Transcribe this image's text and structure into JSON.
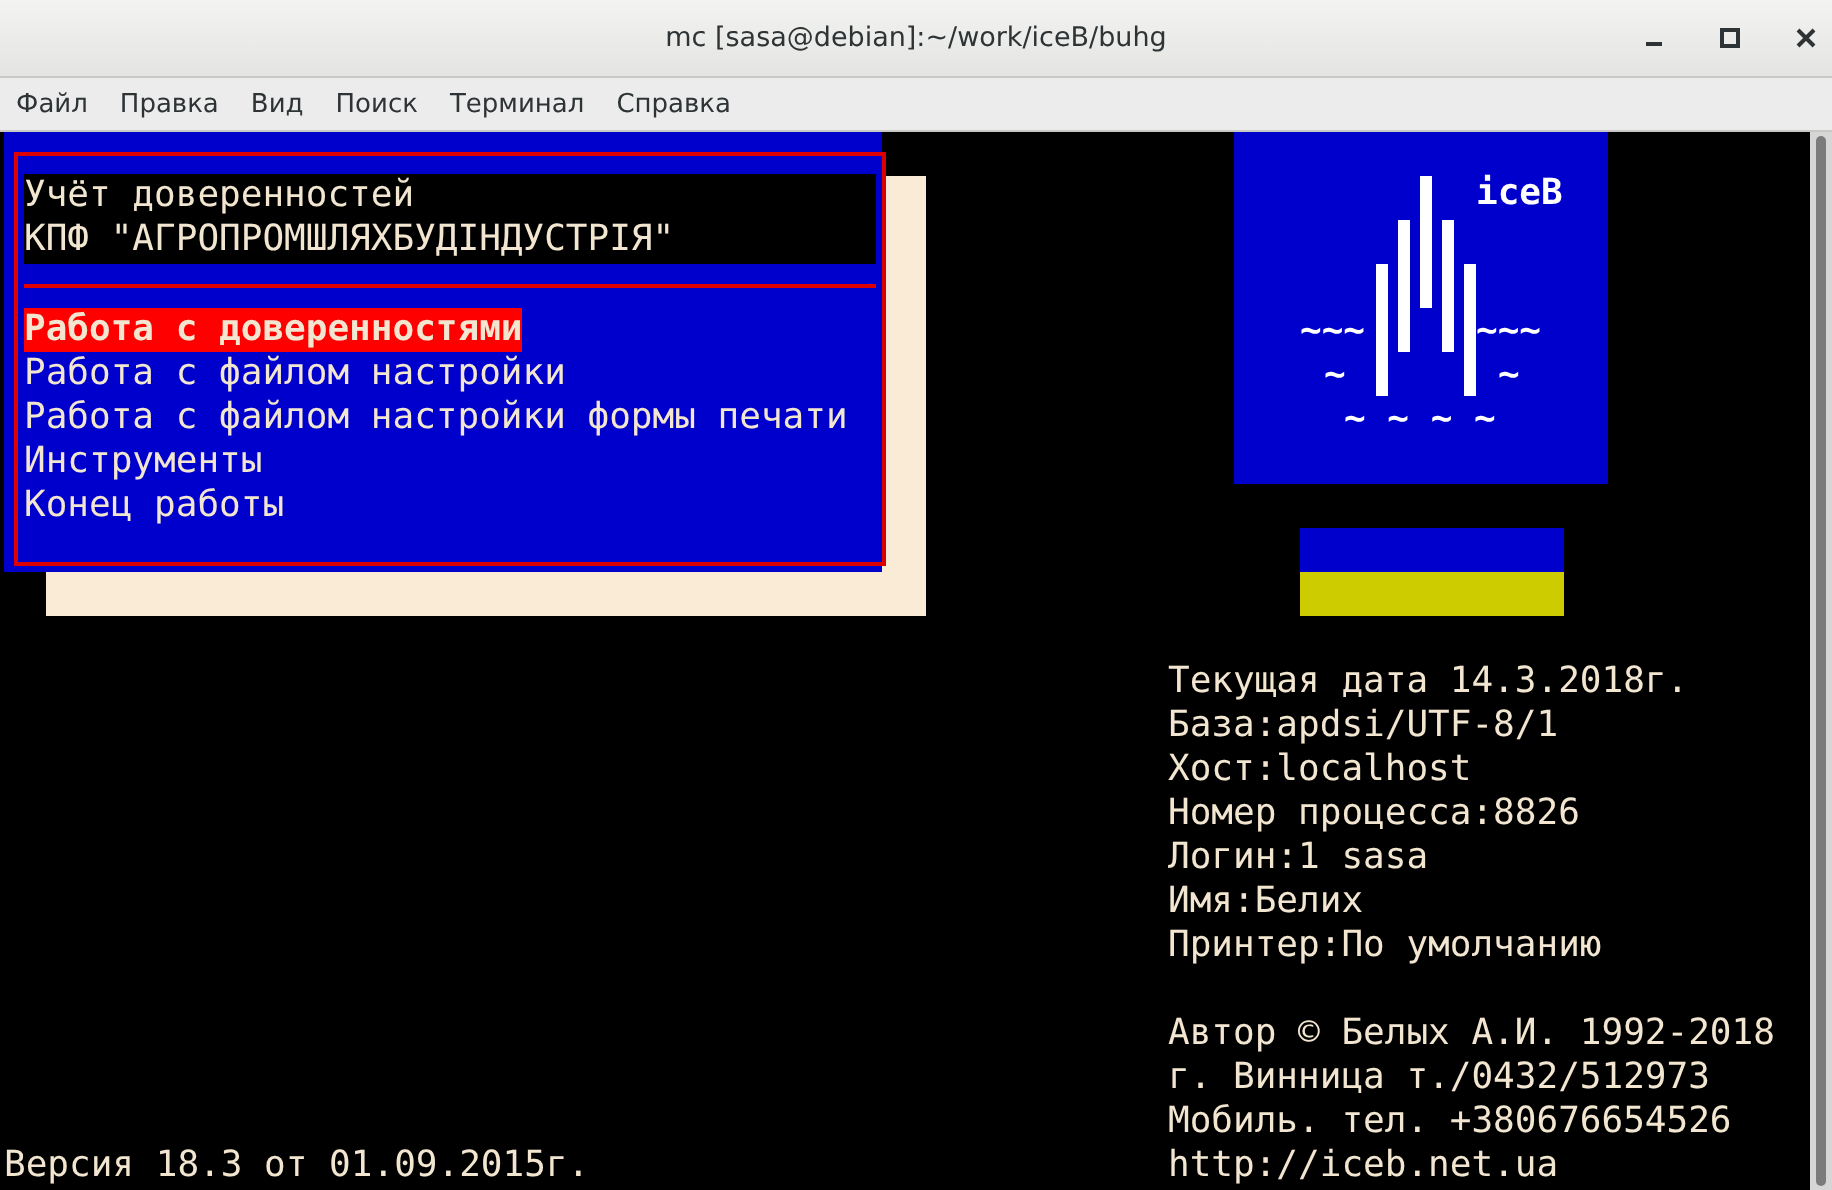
{
  "window": {
    "title": "mc [sasa@debian]:~/work/iceB/buhg"
  },
  "menu": [
    "Файл",
    "Правка",
    "Вид",
    "Поиск",
    "Терминал",
    "Справка"
  ],
  "dialog": {
    "header": [
      "Учёт доверенностей",
      "КПФ \"АГРОПРОМШЛЯХБУДІНДУСТРІЯ\""
    ],
    "items": [
      {
        "label": "Работа с доверенностями",
        "selected": true
      },
      {
        "label": "Работа с файлом настройки",
        "selected": false
      },
      {
        "label": "Работа с файлом настройки формы печати",
        "selected": false
      },
      {
        "label": "Инструменты",
        "selected": false
      },
      {
        "label": "Конец работы",
        "selected": false
      }
    ]
  },
  "logo": {
    "title": "iceB",
    "waves": [
      "~~~",
      "~~~",
      "~",
      "~",
      "~ ~ ~ ~"
    ]
  },
  "info": [
    "Текущая дата 14.3.2018г.",
    "База:apdsi/UTF-8/1",
    "Хост:localhost",
    "Номер процесса:8826",
    "Логин:1 sasa",
    "Имя:Белих",
    "Принтер:По умолчанию"
  ],
  "credits": [
    "Автор © Белых А.И. 1992-2018",
    "г. Винница т./0432/512973",
    "Мобиль. тел. +380676654526",
    "http://iceb.net.ua"
  ],
  "version": "Версия 18.3 от 01.09.2015г."
}
